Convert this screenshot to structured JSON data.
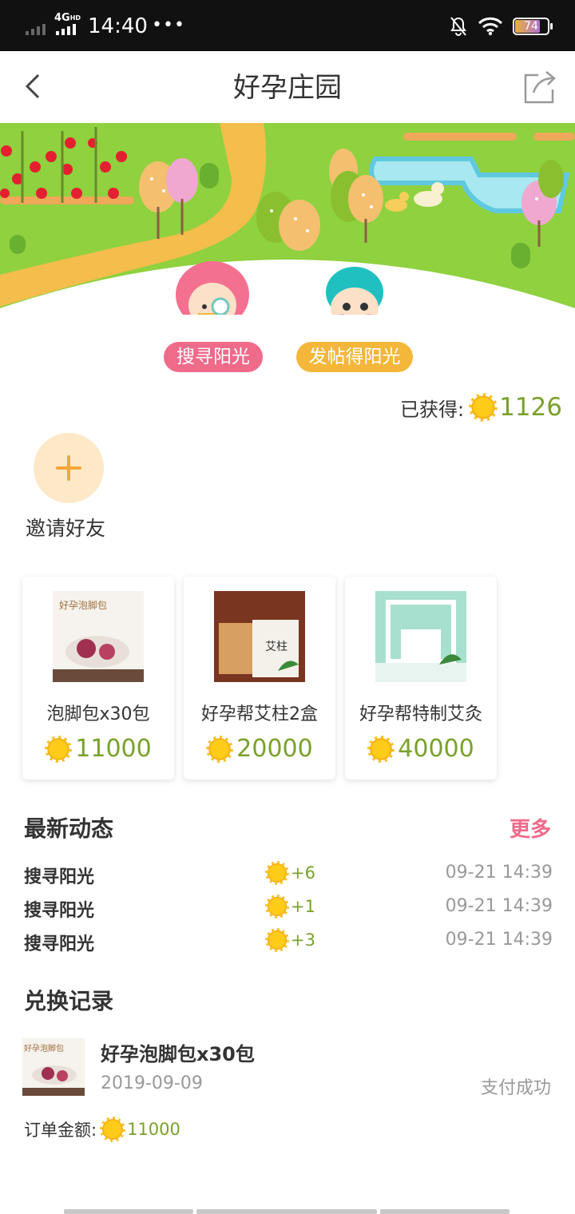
{
  "status_bar": {
    "network": "4G",
    "network_sup": "HD",
    "time": "14:40",
    "dots": "•••",
    "battery": "74",
    "icons": [
      "signal-icon",
      "mute-bell-icon",
      "wifi-icon",
      "battery-icon"
    ]
  },
  "nav": {
    "title": "好孕庄园",
    "back_icon": "back-arrow-icon",
    "share_icon": "share-icon"
  },
  "banner": {
    "actions": [
      {
        "label": "搜寻阳光",
        "color": "#f06a8a"
      },
      {
        "label": "发帖得阳光",
        "color": "#f4b73a"
      }
    ]
  },
  "earned": {
    "label": "已获得:",
    "value": "1126"
  },
  "invite": {
    "label": "邀请好友"
  },
  "products": [
    {
      "name": "泡脚包x30包",
      "price": "11000",
      "thumb_title": "好孕泡脚包"
    },
    {
      "name": "好孕帮艾柱2盒",
      "price": "20000",
      "thumb_title": "艾柱"
    },
    {
      "name": "好孕帮特制艾灸",
      "price": "40000"
    }
  ],
  "activity": {
    "title": "最新动态",
    "more": "更多",
    "items": [
      {
        "label": "搜寻阳光",
        "gain": "+6",
        "time": "09-21 14:39"
      },
      {
        "label": "搜寻阳光",
        "gain": "+1",
        "time": "09-21 14:39"
      },
      {
        "label": "搜寻阳光",
        "gain": "+3",
        "time": "09-21 14:39"
      }
    ]
  },
  "records": {
    "title": "兑换记录",
    "item": {
      "name": "好孕泡脚包x30包",
      "thumb_title": "好孕泡脚包",
      "date": "2019-09-09",
      "status": "支付成功",
      "amount_label": "订单金额:",
      "amount": "11000"
    }
  },
  "colors": {
    "accent_pink": "#f06a8a",
    "accent_orange": "#f4b73a",
    "sun_value_green": "#7aa12a",
    "banner_grass": "#8fd13f"
  }
}
